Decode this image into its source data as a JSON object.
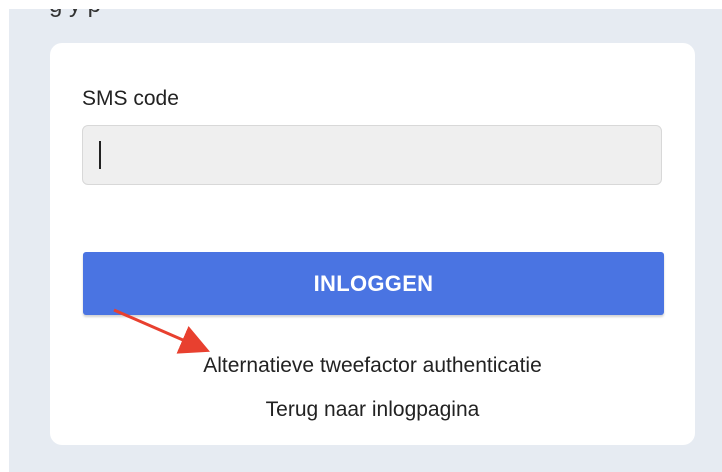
{
  "form": {
    "field_label": "SMS code",
    "field_value": "",
    "login_button_label": "INLOGGEN"
  },
  "links": {
    "alternative_2fa": "Alternatieve tweefactor authenticatie",
    "back_to_login": "Terug naar inlogpagina"
  },
  "annotation": {
    "arrow_color": "#e8402f",
    "icon": "red-arrow-icon"
  },
  "colors": {
    "background": "#e6ebf2",
    "button": "#4a74e2"
  }
}
